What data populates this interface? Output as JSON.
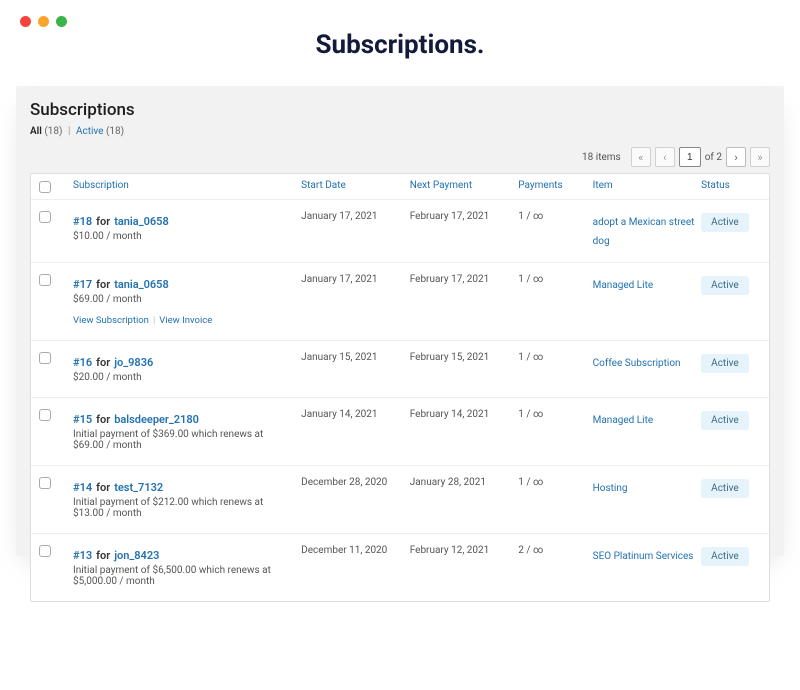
{
  "pageTitle": "Subscriptions.",
  "panelHeading": "Subscriptions",
  "filters": {
    "allLabel": "All",
    "allCount": "(18)",
    "activeLabel": "Active",
    "activeCount": "(18)"
  },
  "nav": {
    "itemsLabel": "18 items",
    "page": "1",
    "ofLabel": "of 2",
    "first": "«",
    "prev": "‹",
    "next": "›",
    "last": "»"
  },
  "columns": {
    "subscription": "Subscription",
    "startDate": "Start Date",
    "nextPayment": "Next Payment",
    "payments": "Payments",
    "item": "Item",
    "status": "Status"
  },
  "actionLinks": {
    "viewSubscription": "View Subscription",
    "viewInvoice": "View Invoice"
  },
  "rows": [
    {
      "orderId": "#18",
      "forWord": "for",
      "user": "tania_0658",
      "price": "$10.00 / month",
      "start": "January 17, 2021",
      "next": "February 17, 2021",
      "payments": "1 / ∞",
      "item": "adopt a Mexican street dog",
      "status": "Active",
      "showActions": false
    },
    {
      "orderId": "#17",
      "forWord": "for",
      "user": "tania_0658",
      "price": "$69.00 / month",
      "start": "January 17, 2021",
      "next": "February 17, 2021",
      "payments": "1 / ∞",
      "item": "Managed Lite",
      "status": "Active",
      "showActions": true
    },
    {
      "orderId": "#16",
      "forWord": "for",
      "user": "jo_9836",
      "price": "$20.00 / month",
      "start": "January 15, 2021",
      "next": "February 15, 2021",
      "payments": "1 / ∞",
      "item": "Coffee Subscription",
      "status": "Active",
      "showActions": false
    },
    {
      "orderId": "#15",
      "forWord": "for",
      "user": "balsdeeper_2180",
      "price": "Initial payment of $369.00 which renews at $69.00 / month",
      "start": "January 14, 2021",
      "next": "February 14, 2021",
      "payments": "1 / ∞",
      "item": "Managed Lite",
      "status": "Active",
      "showActions": false
    },
    {
      "orderId": "#14",
      "forWord": "for",
      "user": "test_7132",
      "price": "Initial payment of $212.00 which renews at $13.00 / month",
      "start": "December 28, 2020",
      "next": "January 28, 2021",
      "payments": "1 / ∞",
      "item": "Hosting",
      "status": "Active",
      "showActions": false
    },
    {
      "orderId": "#13",
      "forWord": "for",
      "user": "jon_8423",
      "price": "Initial payment of $6,500.00 which renews at $5,000.00 / month",
      "start": "December 11, 2020",
      "next": "February 12, 2021",
      "payments": "2 / ∞",
      "item": "SEO Platinum Services",
      "status": "Active",
      "showActions": false
    }
  ]
}
